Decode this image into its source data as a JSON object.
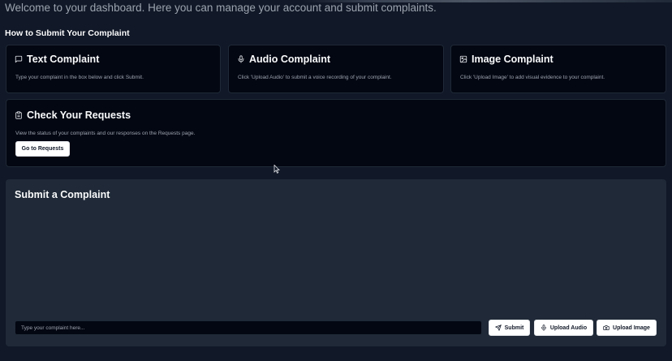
{
  "header": {
    "welcome_text": "Welcome to your dashboard. Here you can manage your account and submit complaints."
  },
  "how_to": {
    "title": "How to Submit Your Complaint",
    "cards": [
      {
        "icon": "message-square-icon",
        "title": "Text Complaint",
        "description": "Type your complaint in the box below and click Submit."
      },
      {
        "icon": "microphone-icon",
        "title": "Audio Complaint",
        "description": "Click 'Upload Audio' to submit a voice recording of your complaint."
      },
      {
        "icon": "image-icon",
        "title": "Image Complaint",
        "description": "Click 'Upload Image' to add visual evidence to your complaint."
      }
    ]
  },
  "requests_card": {
    "icon": "clipboard-icon",
    "title": "Check Your Requests",
    "description": "View the status of your complaints and our responses on the Requests page.",
    "button_label": "Go to Requests"
  },
  "submit_section": {
    "title": "Submit a Complaint",
    "input_placeholder": "Type your complaint here...",
    "input_value": "",
    "submit_label": "Submit",
    "upload_audio_label": "Upload Audio",
    "upload_image_label": "Upload Image"
  },
  "colors": {
    "background": "#111827",
    "card_background": "#030712",
    "panel_background": "#1f2937",
    "button_background": "#ffffff",
    "muted_text": "#9ca3af"
  }
}
